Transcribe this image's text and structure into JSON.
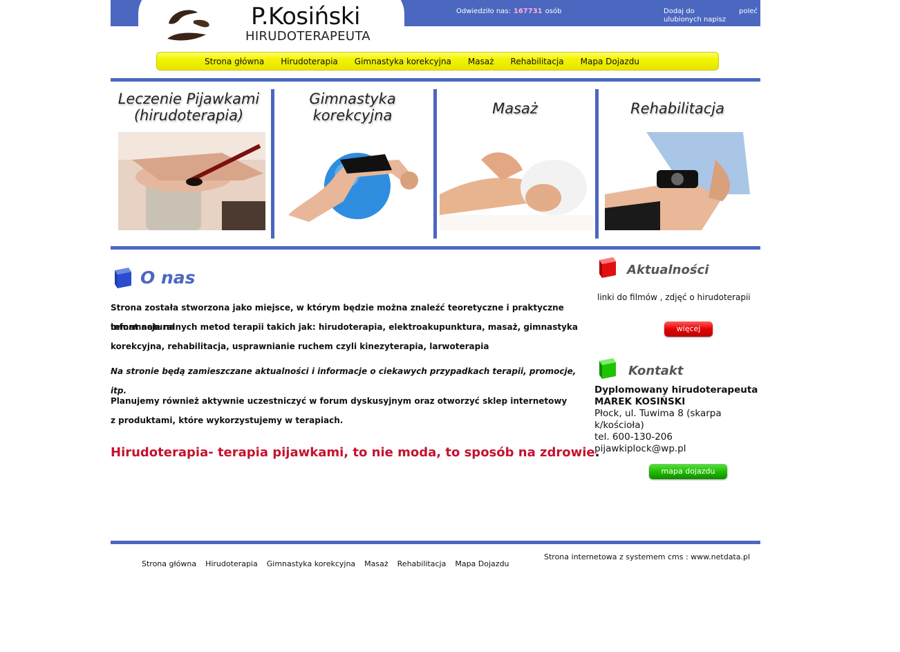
{
  "header": {
    "brand_name": "P.Kosiński",
    "brand_sub": "HIRUDOTERAPEUTA",
    "visits_label": "Odwiedziło nas:",
    "visits_count": "167731",
    "visits_unit": "osób",
    "favorites_label": "Dodaj do ulubionych napisz",
    "recommend_label": "poleć"
  },
  "nav": {
    "items": [
      "Strona główna",
      "Hirudoterapia",
      "Gimnastyka korekcyjna",
      "Masaż",
      "Rehabilitacja",
      "Mapa Dojazdu"
    ]
  },
  "tiles": [
    {
      "line1": "Leczenie Pijawkami",
      "line2": "(hirudoterapia)"
    },
    {
      "line1": "Gimnastyka",
      "line2": "korekcyjna"
    },
    {
      "line1": "Masaż",
      "line2": ""
    },
    {
      "line1": "Rehabilitacja",
      "line2": ""
    }
  ],
  "about": {
    "title": "O nas",
    "p1a": "Strona została stworzona jako miejsce, w którym będzie można znaleźć teoretyczne i praktyczne informacje na",
    "p1b": "temat naturalnych metod terapii takich jak: hirudoterapia, elektroakupunktura, masaż, gimnastyka",
    "p1c": "korekcyjna, rehabilitacja, usprawnianie ruchem czyli kinezyterapia, larwoterapia",
    "p2": "Na stronie będą zamieszczane aktualności i informacje o ciekawych przypadkach terapii, promocje, itp.",
    "p3a": "Planujemy również aktywnie uczestniczyć w forum dyskusyjnym oraz otworzyć sklep internetowy",
    "p3b": "z produktami, które wykorzystujemy w terapiach.",
    "slogan": "Hirudoterapia- terapia pijawkami, to nie moda, to sposób na zdrowie",
    "slogan_end": "."
  },
  "news": {
    "title": "Aktualności",
    "text": "linki do filmów , zdjęć o hirudoterapii",
    "more_button": "więcej"
  },
  "contact": {
    "title": "Kontakt",
    "line1": "Dyplomowany hirudoterapeuta",
    "line2": "MAREK KOSIŃSKI",
    "line3": "Płock, ul. Tuwima 8 (skarpa",
    "line4": "k/kościoła)",
    "line5": "tel. 600-130-206",
    "line6": "pijawkiplock@wp.pl",
    "map_button": "mapa dojazdu"
  },
  "footer": {
    "nav": [
      "Strona główna",
      "Hirudoterapia",
      "Gimnastyka korekcyjna",
      "Masaż",
      "Rehabilitacja",
      "Mapa Dojazdu"
    ],
    "credit": "Strona internetowa z systemem cms : www.netdata.pl"
  },
  "colors": {
    "accent_blue": "#4b67bf",
    "nav_yellow": "#f3f300",
    "slogan_red": "#c4122f",
    "button_red": "#e60000",
    "button_green": "#1fbf00"
  },
  "icons": {
    "logo": "leech-logo-icon",
    "about_cube": "blue-cube-icon",
    "news_cube": "red-cube-icon",
    "contact_cube": "green-cube-icon"
  }
}
